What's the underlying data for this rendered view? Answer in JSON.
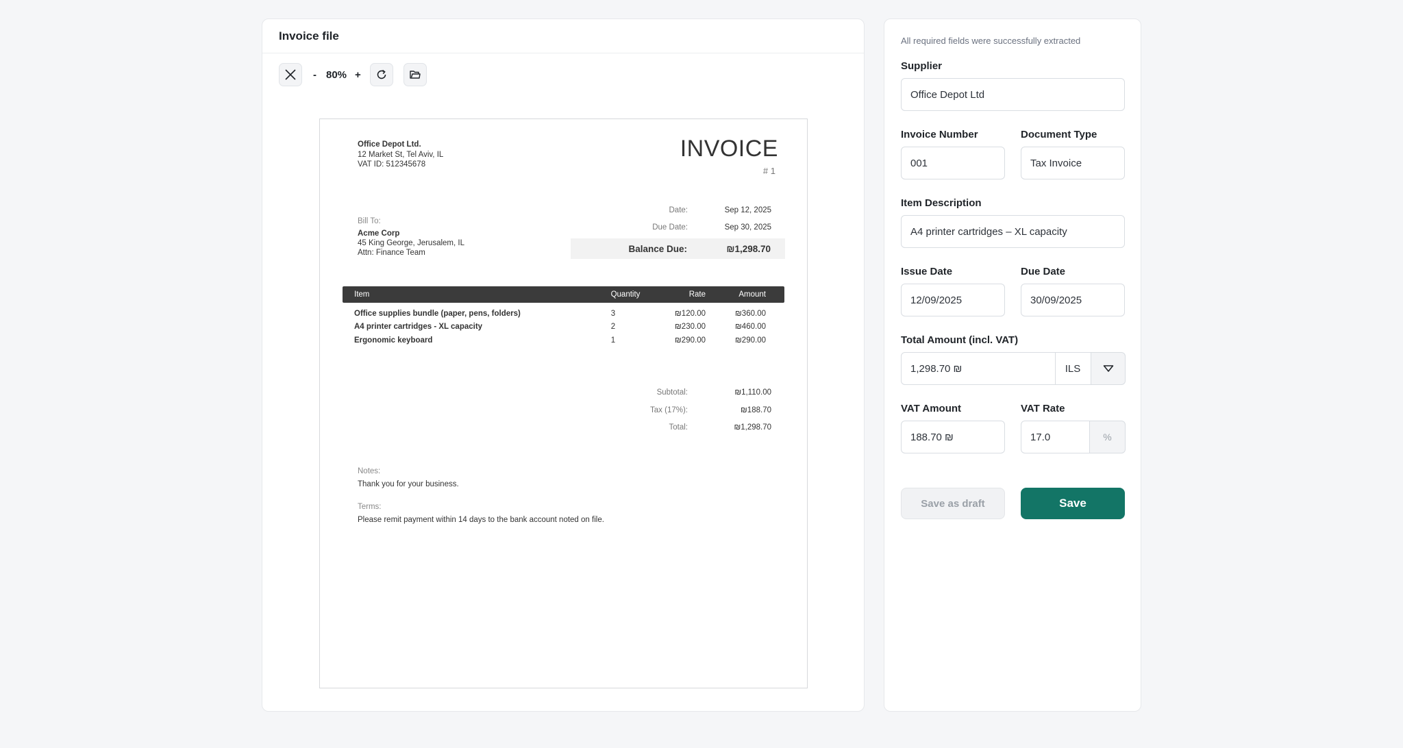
{
  "viewer": {
    "title": "Invoice file",
    "toolbar": {
      "close_icon": "close-icon",
      "zoom_out": "-",
      "zoom_level": "80%",
      "zoom_in": "+",
      "refresh_icon": "refresh-icon",
      "folder_icon": "folder-icon"
    },
    "document": {
      "from": {
        "company": "Office Depot Ltd.",
        "address": "12 Market St, Tel Aviv, IL",
        "vat": "VAT ID: 512345678"
      },
      "title": "INVOICE",
      "number": "# 1",
      "bill_to": {
        "label": "Bill To:",
        "name": "Acme Corp",
        "address": "45 King George, Jerusalem, IL",
        "attn": "Attn: Finance Team"
      },
      "date_label": "Date:",
      "date": "Sep 12, 2025",
      "due_label": "Due Date:",
      "due": "Sep 30, 2025",
      "balance_label": "Balance Due:",
      "balance": "₪1,298.70",
      "columns": [
        "Item",
        "Quantity",
        "Rate",
        "Amount"
      ],
      "items": [
        {
          "name": "Office supplies bundle (paper, pens, folders)",
          "qty": "3",
          "rate": "₪120.00",
          "amount": "₪360.00"
        },
        {
          "name": "A4 printer cartridges - XL capacity",
          "qty": "2",
          "rate": "₪230.00",
          "amount": "₪460.00"
        },
        {
          "name": "Ergonomic keyboard",
          "qty": "1",
          "rate": "₪290.00",
          "amount": "₪290.00"
        }
      ],
      "subtotal_label": "Subtotal:",
      "subtotal": "₪1,110.00",
      "tax_label": "Tax (17%):",
      "tax": "₪188.70",
      "total_label": "Total:",
      "total": "₪1,298.70",
      "notes_label": "Notes:",
      "notes": "Thank you for your business.",
      "terms_label": "Terms:",
      "terms": "Please remit payment within 14 days to the bank account noted on file."
    }
  },
  "form": {
    "status": "All required fields were successfully extracted",
    "supplier_label": "Supplier",
    "supplier": "Office Depot Ltd",
    "invoice_number_label": "Invoice Number",
    "invoice_number": "001",
    "document_type_label": "Document Type",
    "document_type": "Tax Invoice",
    "item_description_label": "Item Description",
    "item_description": "A4 printer cartridges – XL capacity",
    "issue_date_label": "Issue Date",
    "issue_date": "12/09/2025",
    "due_date_label": "Due Date",
    "due_date": "30/09/2025",
    "total_amount_label": "Total Amount (incl. VAT)",
    "total_amount": "1,298.70 ₪",
    "currency": "ILS",
    "vat_amount_label": "VAT Amount",
    "vat_amount": "188.70 ₪",
    "vat_rate_label": "VAT Rate",
    "vat_rate": "17.0",
    "vat_rate_unit": "%",
    "save_draft_label": "Save as draft",
    "save_label": "Save"
  },
  "colors": {
    "primary": "#137566",
    "background": "#f5f6f8",
    "table_header": "#3b3b3b"
  }
}
